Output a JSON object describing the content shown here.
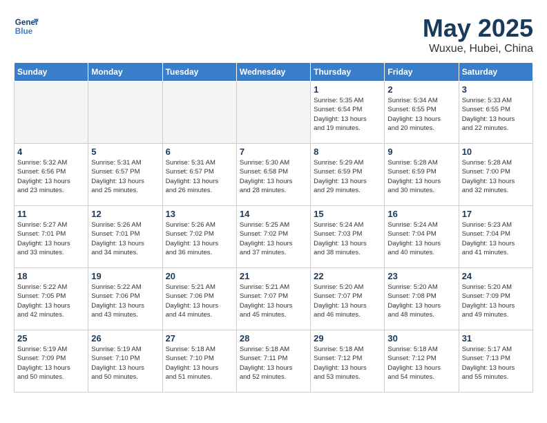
{
  "header": {
    "logo_line1": "General",
    "logo_line2": "Blue",
    "month": "May 2025",
    "location": "Wuxue, Hubei, China"
  },
  "days_of_week": [
    "Sunday",
    "Monday",
    "Tuesday",
    "Wednesday",
    "Thursday",
    "Friday",
    "Saturday"
  ],
  "weeks": [
    [
      {
        "day": "",
        "info": ""
      },
      {
        "day": "",
        "info": ""
      },
      {
        "day": "",
        "info": ""
      },
      {
        "day": "",
        "info": ""
      },
      {
        "day": "1",
        "info": "Sunrise: 5:35 AM\nSunset: 6:54 PM\nDaylight: 13 hours\nand 19 minutes."
      },
      {
        "day": "2",
        "info": "Sunrise: 5:34 AM\nSunset: 6:55 PM\nDaylight: 13 hours\nand 20 minutes."
      },
      {
        "day": "3",
        "info": "Sunrise: 5:33 AM\nSunset: 6:55 PM\nDaylight: 13 hours\nand 22 minutes."
      }
    ],
    [
      {
        "day": "4",
        "info": "Sunrise: 5:32 AM\nSunset: 6:56 PM\nDaylight: 13 hours\nand 23 minutes."
      },
      {
        "day": "5",
        "info": "Sunrise: 5:31 AM\nSunset: 6:57 PM\nDaylight: 13 hours\nand 25 minutes."
      },
      {
        "day": "6",
        "info": "Sunrise: 5:31 AM\nSunset: 6:57 PM\nDaylight: 13 hours\nand 26 minutes."
      },
      {
        "day": "7",
        "info": "Sunrise: 5:30 AM\nSunset: 6:58 PM\nDaylight: 13 hours\nand 28 minutes."
      },
      {
        "day": "8",
        "info": "Sunrise: 5:29 AM\nSunset: 6:59 PM\nDaylight: 13 hours\nand 29 minutes."
      },
      {
        "day": "9",
        "info": "Sunrise: 5:28 AM\nSunset: 6:59 PM\nDaylight: 13 hours\nand 30 minutes."
      },
      {
        "day": "10",
        "info": "Sunrise: 5:28 AM\nSunset: 7:00 PM\nDaylight: 13 hours\nand 32 minutes."
      }
    ],
    [
      {
        "day": "11",
        "info": "Sunrise: 5:27 AM\nSunset: 7:01 PM\nDaylight: 13 hours\nand 33 minutes."
      },
      {
        "day": "12",
        "info": "Sunrise: 5:26 AM\nSunset: 7:01 PM\nDaylight: 13 hours\nand 34 minutes."
      },
      {
        "day": "13",
        "info": "Sunrise: 5:26 AM\nSunset: 7:02 PM\nDaylight: 13 hours\nand 36 minutes."
      },
      {
        "day": "14",
        "info": "Sunrise: 5:25 AM\nSunset: 7:02 PM\nDaylight: 13 hours\nand 37 minutes."
      },
      {
        "day": "15",
        "info": "Sunrise: 5:24 AM\nSunset: 7:03 PM\nDaylight: 13 hours\nand 38 minutes."
      },
      {
        "day": "16",
        "info": "Sunrise: 5:24 AM\nSunset: 7:04 PM\nDaylight: 13 hours\nand 40 minutes."
      },
      {
        "day": "17",
        "info": "Sunrise: 5:23 AM\nSunset: 7:04 PM\nDaylight: 13 hours\nand 41 minutes."
      }
    ],
    [
      {
        "day": "18",
        "info": "Sunrise: 5:22 AM\nSunset: 7:05 PM\nDaylight: 13 hours\nand 42 minutes."
      },
      {
        "day": "19",
        "info": "Sunrise: 5:22 AM\nSunset: 7:06 PM\nDaylight: 13 hours\nand 43 minutes."
      },
      {
        "day": "20",
        "info": "Sunrise: 5:21 AM\nSunset: 7:06 PM\nDaylight: 13 hours\nand 44 minutes."
      },
      {
        "day": "21",
        "info": "Sunrise: 5:21 AM\nSunset: 7:07 PM\nDaylight: 13 hours\nand 45 minutes."
      },
      {
        "day": "22",
        "info": "Sunrise: 5:20 AM\nSunset: 7:07 PM\nDaylight: 13 hours\nand 46 minutes."
      },
      {
        "day": "23",
        "info": "Sunrise: 5:20 AM\nSunset: 7:08 PM\nDaylight: 13 hours\nand 48 minutes."
      },
      {
        "day": "24",
        "info": "Sunrise: 5:20 AM\nSunset: 7:09 PM\nDaylight: 13 hours\nand 49 minutes."
      }
    ],
    [
      {
        "day": "25",
        "info": "Sunrise: 5:19 AM\nSunset: 7:09 PM\nDaylight: 13 hours\nand 50 minutes."
      },
      {
        "day": "26",
        "info": "Sunrise: 5:19 AM\nSunset: 7:10 PM\nDaylight: 13 hours\nand 50 minutes."
      },
      {
        "day": "27",
        "info": "Sunrise: 5:18 AM\nSunset: 7:10 PM\nDaylight: 13 hours\nand 51 minutes."
      },
      {
        "day": "28",
        "info": "Sunrise: 5:18 AM\nSunset: 7:11 PM\nDaylight: 13 hours\nand 52 minutes."
      },
      {
        "day": "29",
        "info": "Sunrise: 5:18 AM\nSunset: 7:12 PM\nDaylight: 13 hours\nand 53 minutes."
      },
      {
        "day": "30",
        "info": "Sunrise: 5:18 AM\nSunset: 7:12 PM\nDaylight: 13 hours\nand 54 minutes."
      },
      {
        "day": "31",
        "info": "Sunrise: 5:17 AM\nSunset: 7:13 PM\nDaylight: 13 hours\nand 55 minutes."
      }
    ]
  ]
}
